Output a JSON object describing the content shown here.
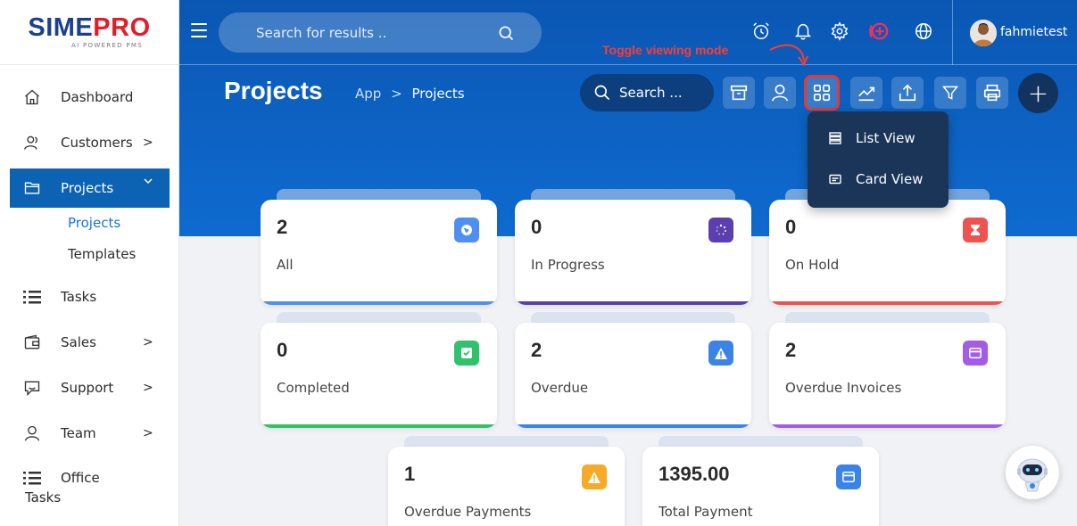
{
  "brand": {
    "logo_part1": "SIME",
    "logo_part2": "PRO",
    "tagline": "AI POWERED PMS"
  },
  "sidebar": {
    "items": [
      {
        "label": "Dashboard",
        "icon": "home-icon"
      },
      {
        "label": "Customers",
        "icon": "customers-icon",
        "chevron": ">"
      },
      {
        "label": "Projects",
        "icon": "folder-icon",
        "chevron": "⌄",
        "active": true
      },
      {
        "label": "Tasks",
        "icon": "list-icon"
      },
      {
        "label": "Sales",
        "icon": "wallet-icon",
        "chevron": ">"
      },
      {
        "label": "Support",
        "icon": "chat-icon",
        "chevron": ">"
      },
      {
        "label": "Team",
        "icon": "team-icon",
        "chevron": ">"
      },
      {
        "label_line1": "Office",
        "label_line2": "Tasks",
        "icon": "list-icon"
      }
    ],
    "submenu": [
      {
        "label": "Projects",
        "active": true
      },
      {
        "label": "Templates"
      }
    ]
  },
  "topbar": {
    "search_placeholder": "Search for results ..",
    "username": "fahmietest",
    "icons": [
      "menu-icon",
      "search-icon",
      "alarm-icon",
      "bell-icon",
      "gear-icon",
      "add-circle-icon",
      "globe-icon",
      "avatar"
    ]
  },
  "annotation": {
    "text": "Toggle viewing mode"
  },
  "page": {
    "title": "Projects",
    "breadcrumb_root": "App",
    "breadcrumb_sep": ">",
    "breadcrumb_current": "Projects",
    "search_placeholder": "Search ...",
    "add_label": "+"
  },
  "toolbar": [
    "archive-icon",
    "user-icon",
    "grid-view-icon",
    "chart-icon",
    "upload-icon",
    "filter-icon",
    "print-icon"
  ],
  "view_menu": [
    {
      "label": "List View",
      "icon": "list-view-icon"
    },
    {
      "label": "Card View",
      "icon": "card-view-icon"
    }
  ],
  "stats": [
    {
      "value": "2",
      "label": "All",
      "icon": "globe-icon",
      "color": "#4f8ff0"
    },
    {
      "value": "0",
      "label": "In Progress",
      "icon": "spinner-icon",
      "color": "#5b3fae"
    },
    {
      "value": "0",
      "label": "On Hold",
      "icon": "hourglass-icon",
      "color": "#ef5350"
    },
    {
      "value": "0",
      "label": "Completed",
      "icon": "check-icon",
      "color": "#2ec26a"
    },
    {
      "value": "2",
      "label": "Overdue",
      "icon": "warning-icon",
      "color": "#3c83e8"
    },
    {
      "value": "2",
      "label": "Overdue Invoices",
      "icon": "card-icon",
      "color": "#a25de6"
    },
    {
      "value": "1",
      "label": "Overdue Payments",
      "icon": "warning-icon",
      "color": "#f7a928"
    },
    {
      "value": "1395.00",
      "label": "Total Payment",
      "icon": "card-icon",
      "color": "#3c83e8"
    }
  ]
}
